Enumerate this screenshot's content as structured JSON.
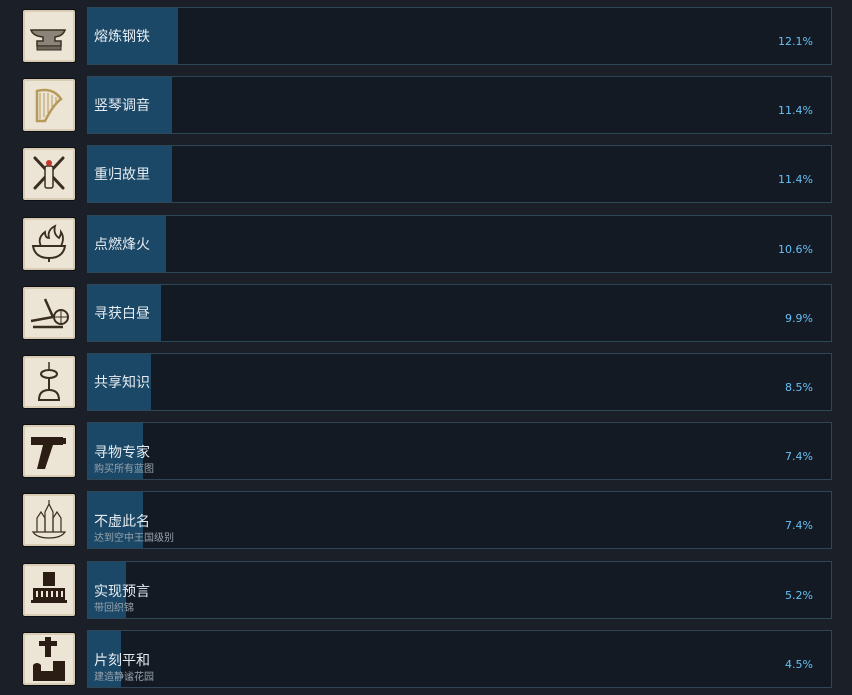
{
  "achievements": [
    {
      "title": "熔炼钢铁",
      "description": "",
      "percent_label": "12.1%",
      "percent": 12.1,
      "icon": "anvil-icon"
    },
    {
      "title": "竖琴调音",
      "description": "",
      "percent_label": "11.4%",
      "percent": 11.4,
      "icon": "harp-icon"
    },
    {
      "title": "重归故里",
      "description": "",
      "percent_label": "11.4%",
      "percent": 11.4,
      "icon": "crossed-tools-icon"
    },
    {
      "title": "点燃烽火",
      "description": "",
      "percent_label": "10.6%",
      "percent": 10.6,
      "icon": "beacon-fire-icon"
    },
    {
      "title": "寻获白昼",
      "description": "",
      "percent_label": "9.9%",
      "percent": 9.9,
      "icon": "lever-machine-icon"
    },
    {
      "title": "共享知识",
      "description": "",
      "percent_label": "8.5%",
      "percent": 8.5,
      "icon": "tower-pedestal-icon"
    },
    {
      "title": "寻物专家",
      "description": "购买所有蓝图",
      "percent_label": "7.4%",
      "percent": 7.4,
      "icon": "hammer-icon"
    },
    {
      "title": "不虚此名",
      "description": "达到空中王国级别",
      "percent_label": "7.4%",
      "percent": 7.4,
      "icon": "sky-kingdom-icon"
    },
    {
      "title": "实现预言",
      "description": "带回织锦",
      "percent_label": "5.2%",
      "percent": 5.2,
      "icon": "tapestry-building-icon"
    },
    {
      "title": "片刻平和",
      "description": "建造静谧花园",
      "percent_label": "4.5%",
      "percent": 4.5,
      "icon": "garden-cross-icon"
    }
  ],
  "colors": {
    "background": "#1b2028",
    "panel": "#131a24",
    "progress_fill": "#1a4866",
    "percent_text": "#66c0f4",
    "icon_background": "#ece4d4"
  }
}
